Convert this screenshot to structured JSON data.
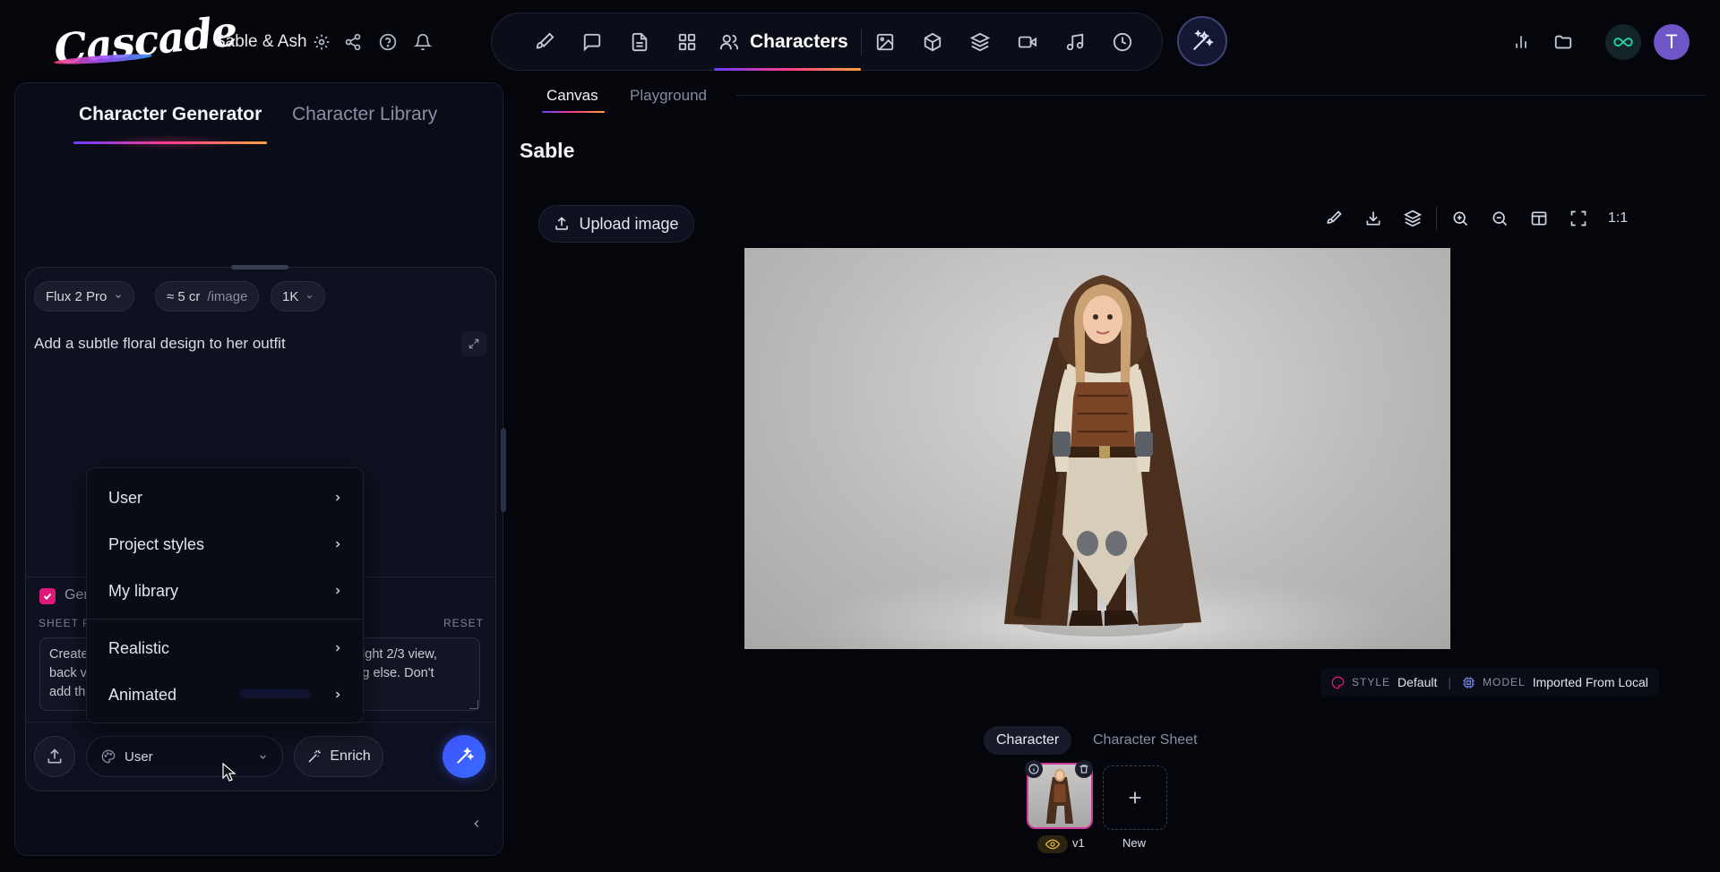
{
  "app": {
    "logo_text": "Cascade",
    "project_title": "Sable & Ash"
  },
  "nav": {
    "active_label": "Characters",
    "items_left": [
      "brush-icon",
      "chat-icon",
      "document-icon",
      "grid-icon"
    ],
    "items_right": [
      "image-icon",
      "cube-icon",
      "layers-icon",
      "video-icon",
      "music-icon",
      "history-icon"
    ]
  },
  "account": {
    "avatar_initial": "T"
  },
  "left_panel": {
    "tabs": [
      {
        "label": "Character Generator",
        "active": true
      },
      {
        "label": "Character Library",
        "active": false
      }
    ],
    "model_chip": "Flux 2 Pro",
    "cost_chip": "≈ 5 cr",
    "cost_unit": "/image",
    "resolution_chip": "1K",
    "prompt": "Add a subtle floral design to her outfit",
    "generate_sheet_label": "Gen",
    "generate_sheet_checked": true,
    "sheet_prompt_label": "SHEET P",
    "reset_label": "RESET",
    "sheet_prompt_left": [
      "Create",
      "back v",
      "add th"
    ],
    "sheet_prompt_right": [
      "v, right 2/3 view,",
      "ning else. Don't"
    ],
    "style_select_value": "User",
    "enrich_label": "Enrich"
  },
  "style_dropdown": {
    "items": [
      "User",
      "Project styles",
      "My library",
      "Realistic",
      "Animated"
    ]
  },
  "main": {
    "tabs": [
      {
        "label": "Canvas",
        "active": true
      },
      {
        "label": "Playground",
        "active": false
      }
    ],
    "character_name": "Sable",
    "upload_image_label": "Upload image",
    "zoom_label": "1:1",
    "style_label": "STYLE",
    "style_value": "Default",
    "model_label": "MODEL",
    "model_value": "Imported From Local",
    "sub_tabs": [
      {
        "label": "Character",
        "active": true
      },
      {
        "label": "Character Sheet",
        "active": false
      }
    ],
    "version_label": "v1",
    "new_label": "New"
  },
  "colors": {
    "accent_pink": "#e0187a",
    "accent_blue": "#3d52ff",
    "accent_green": "#21d3a8"
  }
}
